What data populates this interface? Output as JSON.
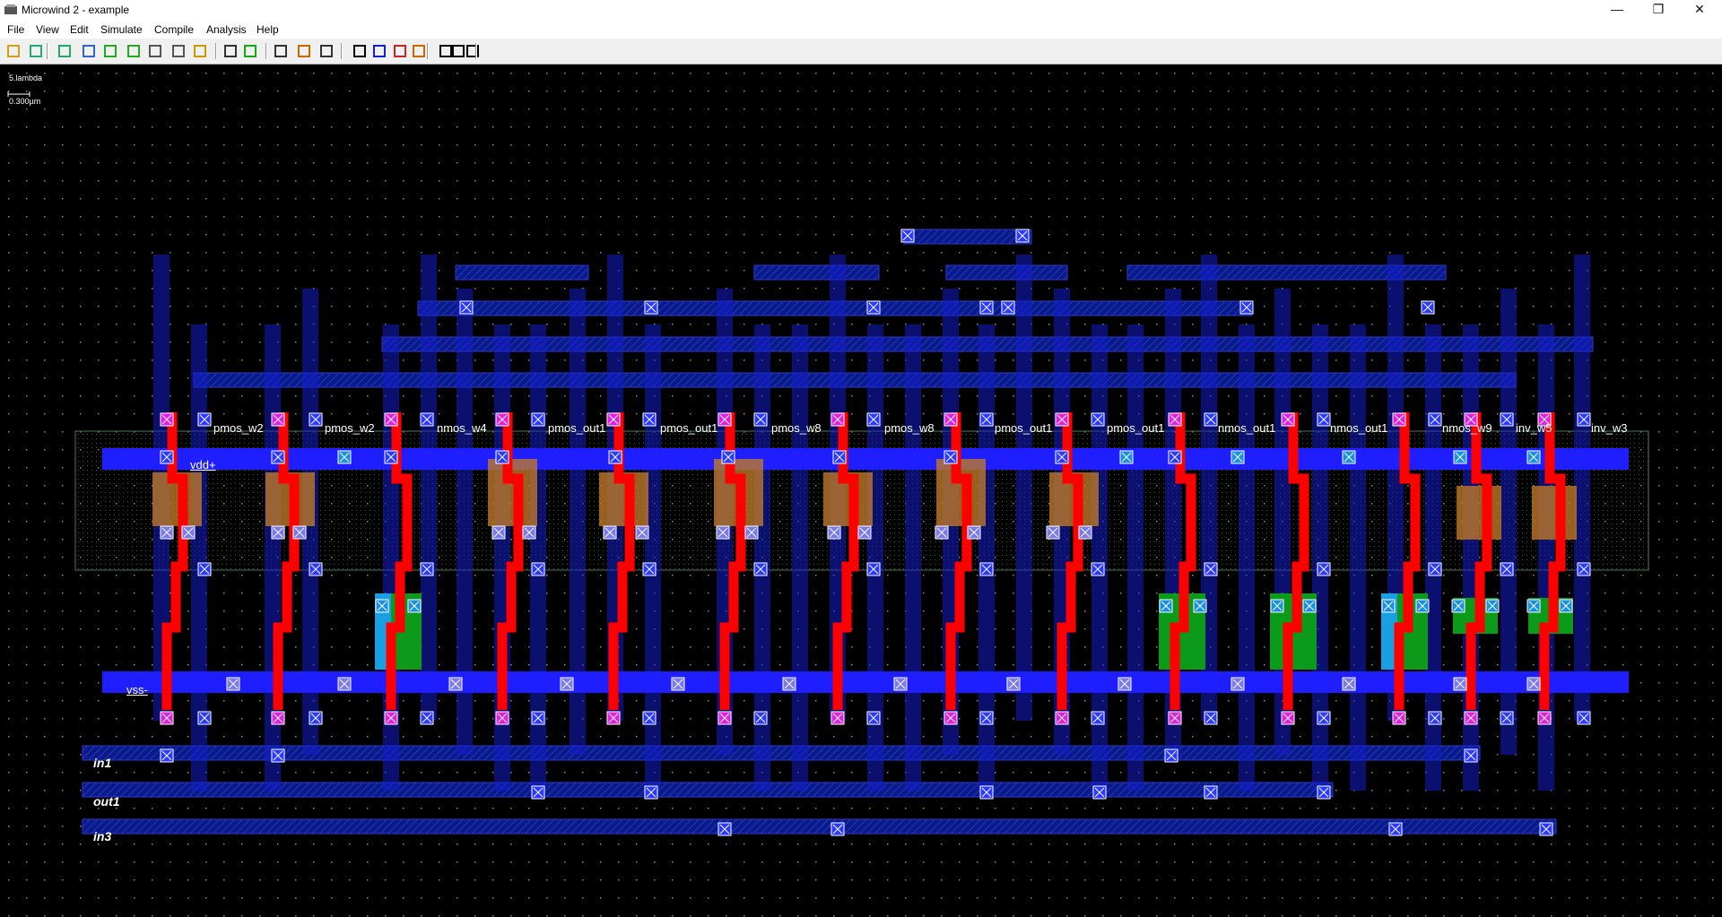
{
  "window": {
    "title": "Microwind 2 - example",
    "minimize": "—",
    "maximize": "❐",
    "close": "✕"
  },
  "menu": [
    "File",
    "View",
    "Edit",
    "Simulate",
    "Compile",
    "Analysis",
    "Help"
  ],
  "toolbar": {
    "icons": [
      "open-icon",
      "save-icon",
      "pen-icon",
      "ruler-icon",
      "copy-icon",
      "move-icon",
      "zoom-in-icon",
      "zoom-out-icon",
      "cell-icon",
      "simulate-icon",
      "run-icon",
      "gauge-icon",
      "connect-icon",
      "extract-icon",
      "text-icon",
      "stack-icon",
      "curve-icon",
      "layers-icon",
      "pan-left-icon",
      "pan-icon",
      "pan-right-icon"
    ]
  },
  "scale": {
    "lambda": "5.lambda",
    "micron": "0.300µm"
  },
  "device_labels": [
    "pmos_w2",
    "pmos_w2",
    "nmos_w4",
    "pmos_out1",
    "pmos_out1",
    "pmos_w8",
    "pmos_w8",
    "pmos_out1",
    "pmos_out1",
    "nmos_out1",
    "nmos_out1",
    "nmos_w9",
    "inv_w5",
    "inv_w3"
  ],
  "nodes": {
    "vdd": "vdd+",
    "vss": "vss-",
    "in1": "in1",
    "out1": "out1",
    "in3": "in3"
  },
  "colors": {
    "background": "#000000",
    "metal1": "#1e1eff",
    "metal2": "#0c1fa8",
    "poly": "#ff0000",
    "contact": "#ff00ff",
    "pdiff": "#b5741a",
    "ndiff": "#0b9a1a",
    "well": "#4a7a4a"
  }
}
